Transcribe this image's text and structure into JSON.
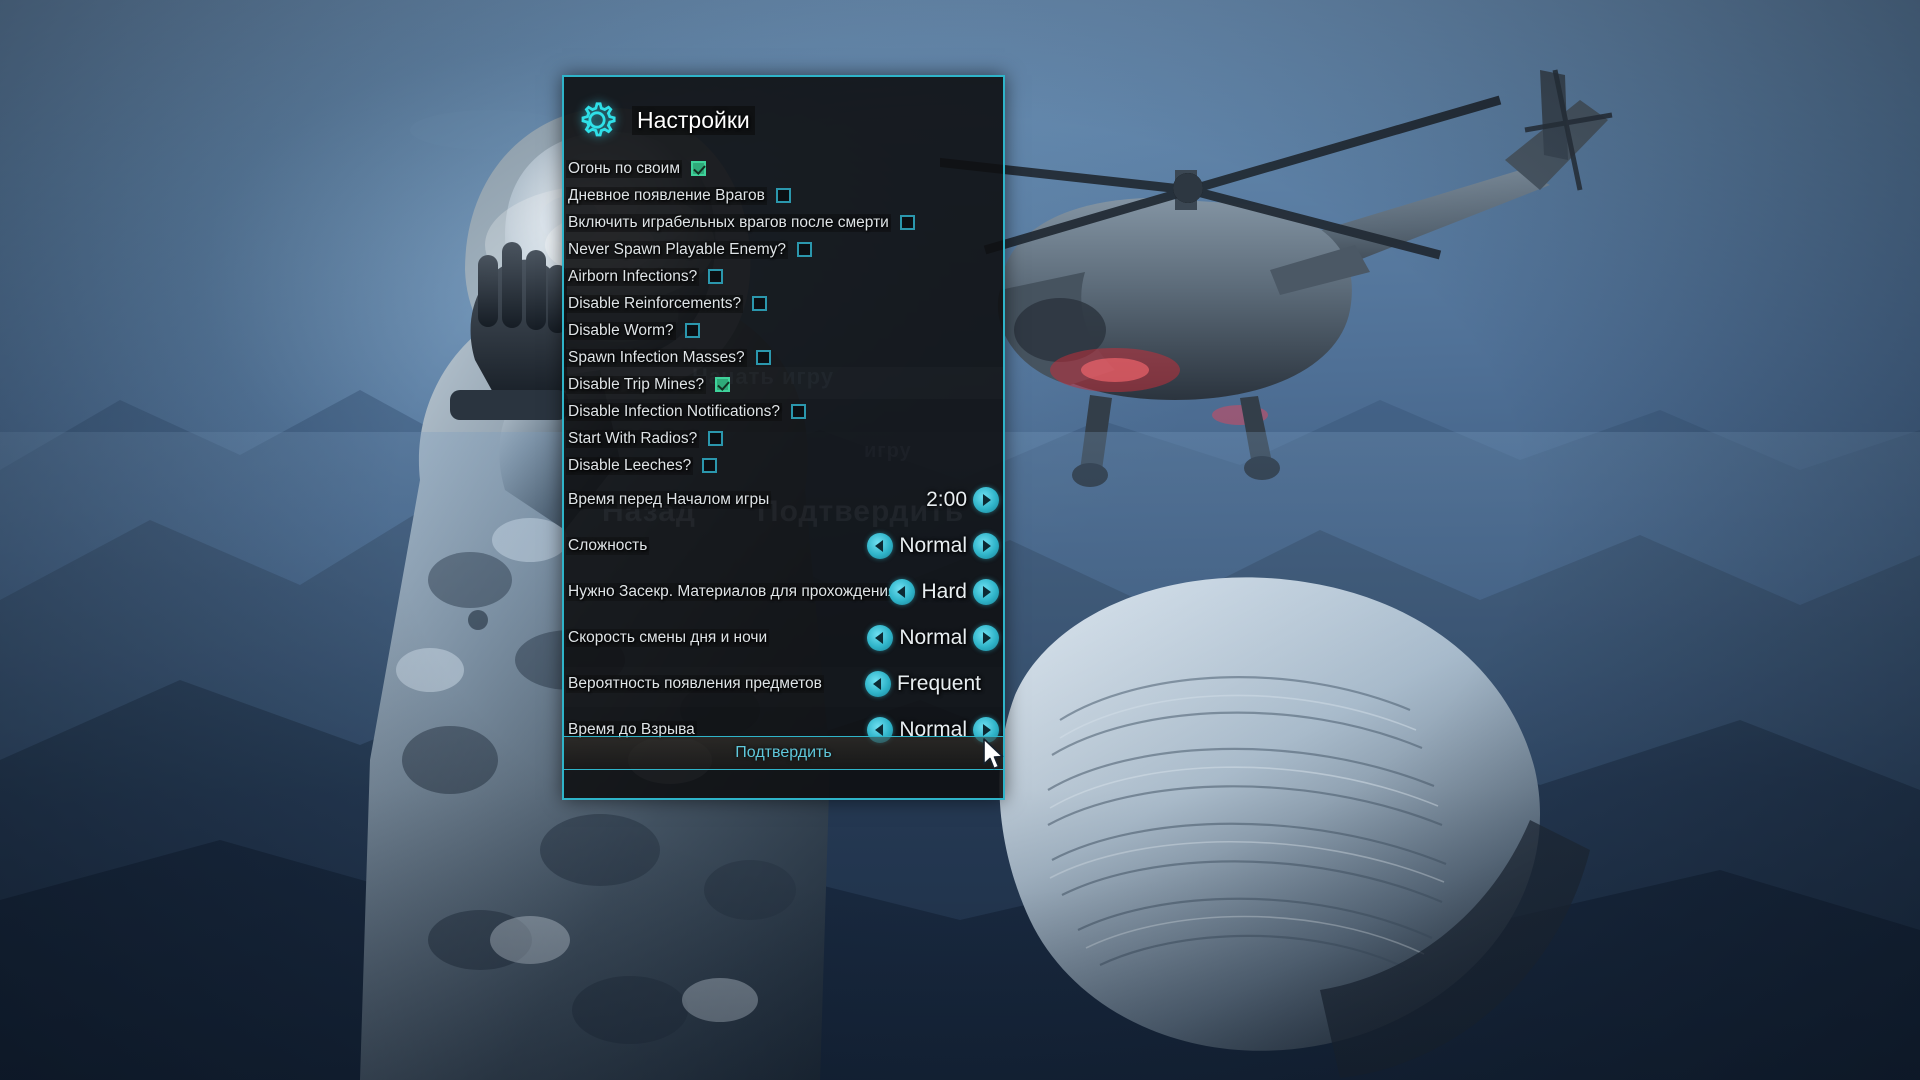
{
  "window": {
    "title": "Настройки",
    "gear_icon": "gear-icon"
  },
  "ghost_text": {
    "back": "Назад",
    "confirm": "Подтвердить",
    "start_game": "Начать игру",
    "игру": "игру"
  },
  "checkboxes": [
    {
      "label": "Огонь по своим",
      "checked": true
    },
    {
      "label": "Дневное появление Врагов",
      "checked": false
    },
    {
      "label": "Включить играбельных врагов после смерти",
      "checked": false
    },
    {
      "label": "Never Spawn Playable Enemy?",
      "checked": false
    },
    {
      "label": "Airborn Infections?",
      "checked": false
    },
    {
      "label": "Disable Reinforcements?",
      "checked": false
    },
    {
      "label": "Disable Worm?",
      "checked": false
    },
    {
      "label": "Spawn Infection Masses?",
      "checked": false
    },
    {
      "label": "Disable Trip Mines?",
      "checked": true
    },
    {
      "label": "Disable Infection Notifications?",
      "checked": false
    },
    {
      "label": "Start With Radios?",
      "checked": false
    },
    {
      "label": "Disable Leeches?",
      "checked": false
    }
  ],
  "selectors": [
    {
      "label": "Время перед Началом игры",
      "value": "2:00",
      "left_arrow": false,
      "right_arrow": true
    },
    {
      "label": "Сложность",
      "value": "Normal",
      "left_arrow": true,
      "right_arrow": true
    },
    {
      "label": "Нужно Засекр. Материалов для прохождения",
      "value": "Hard",
      "left_arrow": true,
      "right_arrow": true
    },
    {
      "label": "Скорость смены дня и ночи",
      "value": "Normal",
      "left_arrow": true,
      "right_arrow": true
    },
    {
      "label": "Вероятность появления предметов",
      "value": "Frequent",
      "left_arrow": true,
      "right_arrow": false
    },
    {
      "label": "Время до Взрыва",
      "value": "Normal",
      "left_arrow": true,
      "right_arrow": true
    }
  ],
  "confirm_button": {
    "label": "Подтвердить"
  },
  "colors": {
    "accent": "#2fb4c9",
    "checked": "#2faa7a",
    "panel_bg": "#0e1012",
    "text": "#dfe4e7",
    "confirm_text": "#5fc8dc"
  }
}
